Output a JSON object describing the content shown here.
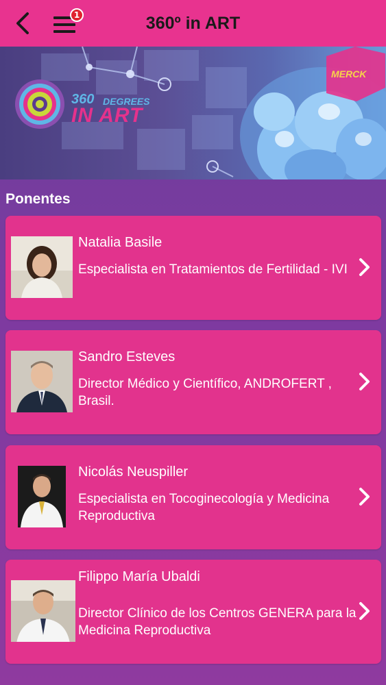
{
  "header": {
    "title": "360º in ART",
    "menu_badge": "1",
    "back_icon": "chevron-left-icon",
    "menu_icon": "hamburger-menu-icon"
  },
  "banner": {
    "logo_number": "360",
    "logo_small": "DEGREES",
    "logo_big": "IN ART",
    "sponsor": "MERCK"
  },
  "section": {
    "title": "Ponentes"
  },
  "speakers": [
    {
      "name": "Natalia Basile",
      "role": "Especialista en Tratamientos de Fertilidad - IVI"
    },
    {
      "name": "Sandro Esteves",
      "role": "Director Médico y Científico, ANDROFERT , Brasil."
    },
    {
      "name": "Nicolás Neuspiller",
      "role": "Especialista en Tocoginecología y Medicina Reproductiva"
    },
    {
      "name": "Filippo María Ubaldi",
      "role": "Director Clínico de los Centros GENERA para la Medicina Reproductiva"
    }
  ],
  "colors": {
    "header_bg": "#e8338f",
    "card_bg": "#e2338d",
    "page_bg": "#7d3aa0"
  }
}
